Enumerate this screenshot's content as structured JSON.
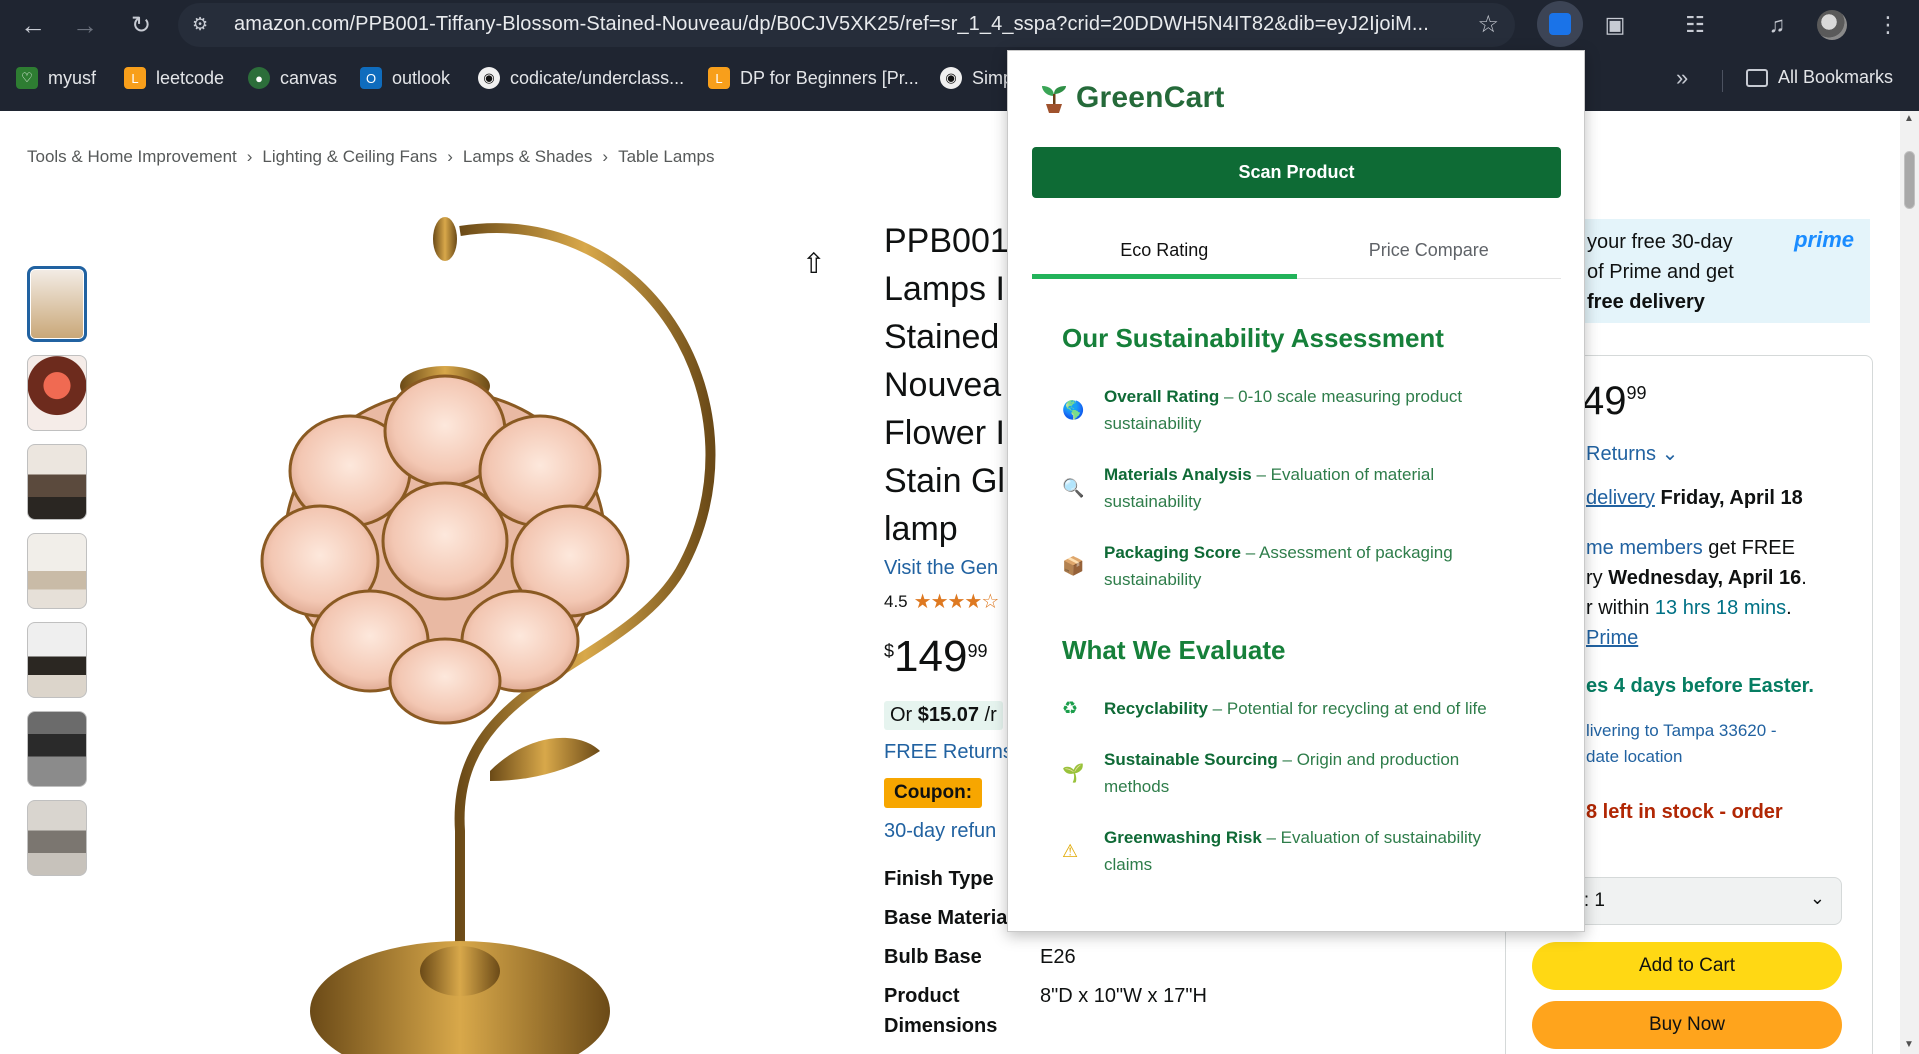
{
  "browser": {
    "url": "amazon.com/PPB001-Tiffany-Blossom-Stained-Nouveau/dp/B0CJV5XK25/ref=sr_1_4_sspa?crid=20DDWH5N4IT82&dib=eyJ2IjoiM...",
    "bookmarks": [
      {
        "label": "myusf",
        "icon": "myusf-icon"
      },
      {
        "label": "leetcode",
        "icon": "leetcode-icon"
      },
      {
        "label": "canvas",
        "icon": "canvas-icon"
      },
      {
        "label": "outlook",
        "icon": "outlook-icon"
      },
      {
        "label": "codicate/underclass...",
        "icon": "github-icon"
      },
      {
        "label": "DP for Beginners [Pr...",
        "icon": "leetcode-icon"
      },
      {
        "label": "Simp",
        "icon": "github-icon"
      }
    ],
    "all_bookmarks": "All Bookmarks"
  },
  "breadcrumb": [
    "Tools & Home Improvement",
    "Lighting & Ceiling Fans",
    "Lamps & Shades",
    "Table Lamps"
  ],
  "product": {
    "title_lines": [
      "PPB001",
      "Lamps I",
      "Stained",
      "Nouvea",
      "Flower I",
      "Stain Gl",
      "lamp"
    ],
    "store": "Visit the Gen",
    "rating": "4.5",
    "stars": "★★★★☆",
    "price_symbol": "$",
    "price_whole": "149",
    "price_cents": "99",
    "or_pay_prefix": "Or ",
    "or_pay_amount": "$15.07",
    "or_pay_suffix": " /r",
    "free_returns": "FREE Returns",
    "coupon": "Coupon:",
    "refund": "30-day refun",
    "specs": [
      {
        "k": "Finish Type",
        "v": ""
      },
      {
        "k": "Base Materia",
        "v": ""
      },
      {
        "k": "Bulb Base",
        "v": "E26"
      },
      {
        "k": "Product Dimensions",
        "v": "8\"D x 10\"W x 17\"H"
      }
    ]
  },
  "buybox": {
    "prime_text_1": " your free 30-day",
    "prime_text_2": "of Prime and get",
    "prime_text_3": " free delivery",
    "prime_logo": "prime",
    "price_whole": "49",
    "price_cents": "99",
    "returns": "Returns",
    "delivery_link": "delivery",
    "delivery_date": " Friday, April 18",
    "members_link": "me members",
    "members_text": " get FREE",
    "fast_prefix": "ry ",
    "fast_date": "Wednesday, April 16",
    "fast_suffix": ".",
    "within_prefix": "r within ",
    "within_time": "13 hrs 18 mins",
    "within_suffix": ".",
    "prime_link": "Prime",
    "easter": "es 4 days before Easter.",
    "deliver_to": "livering to Tampa 33620 -",
    "update_loc": "date location",
    "stock": "8 left in stock - order",
    "qty": "ntity:  1",
    "add_to_cart": "Add to Cart",
    "buy_now": "Buy Now"
  },
  "greencart": {
    "brand": "GreenCart",
    "scan": "Scan Product",
    "tabs": [
      "Eco Rating",
      "Price Compare"
    ],
    "assessment_title": "Our Sustainability Assessment",
    "assessment": [
      {
        "icon": "globe-icon",
        "title": "Overall Rating",
        "desc": " – 0-10 scale measuring product sustainability"
      },
      {
        "icon": "magnifier-icon",
        "title": "Materials Analysis",
        "desc": " – Evaluation of material sustainability"
      },
      {
        "icon": "package-icon",
        "title": "Packaging Score",
        "desc": " – Assessment of packaging sustainability"
      }
    ],
    "evaluate_title": "What We Evaluate",
    "evaluate": [
      {
        "icon": "recycle-icon",
        "title": "Recyclability",
        "desc": " – Potential for recycling at end of life"
      },
      {
        "icon": "seedling-icon",
        "title": "Sustainable Sourcing",
        "desc": " – Origin and production methods"
      },
      {
        "icon": "warning-icon",
        "title": "Greenwashing Risk",
        "desc": " – Evaluation of sustainability claims"
      }
    ]
  }
}
